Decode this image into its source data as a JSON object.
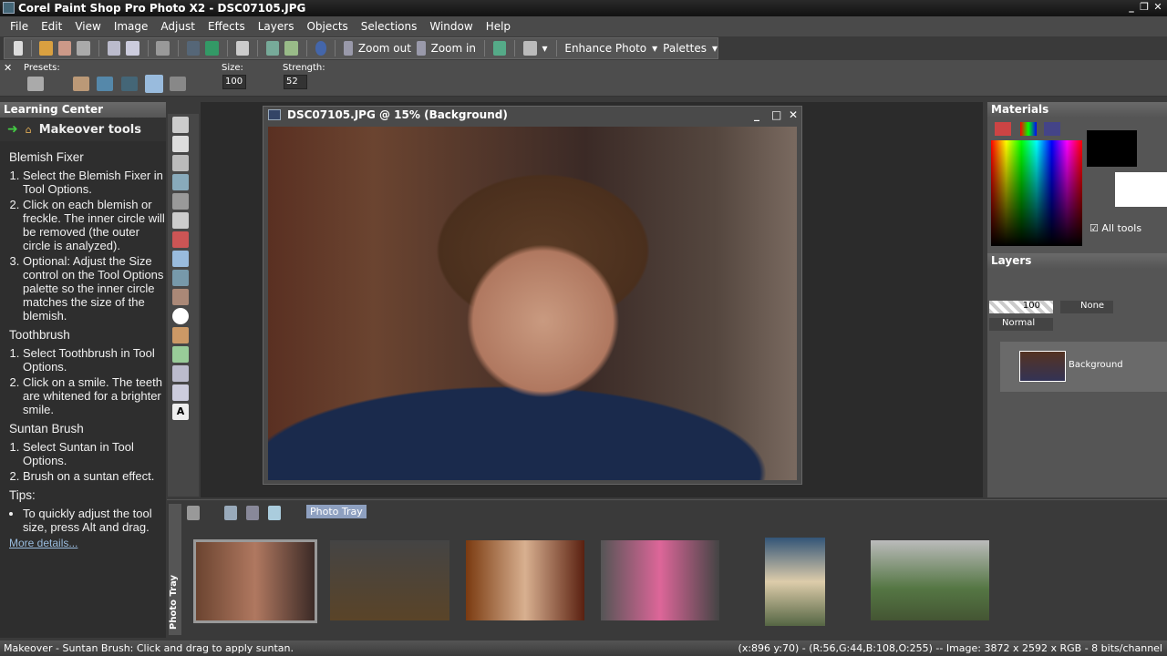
{
  "window": {
    "title": "Corel Paint Shop Pro Photo X2 - DSC07105.JPG"
  },
  "menu": [
    "File",
    "Edit",
    "View",
    "Image",
    "Adjust",
    "Effects",
    "Layers",
    "Objects",
    "Selections",
    "Window",
    "Help"
  ],
  "toolbar": {
    "zoom_out": "Zoom out",
    "zoom_in": "Zoom in",
    "enhance": "Enhance Photo",
    "palettes": "Palettes"
  },
  "options": {
    "presets_label": "Presets:",
    "size_label": "Size:",
    "size_value": "100",
    "strength_label": "Strength:",
    "strength_value": "52"
  },
  "learning": {
    "title": "Learning Center",
    "section": "Makeover tools",
    "groups": [
      {
        "heading": "Blemish Fixer",
        "steps": [
          "Select the Blemish Fixer in Tool Options.",
          "Click on each blemish or freckle. The inner circle will be removed (the outer circle is analyzed).",
          "Optional: Adjust the Size control on the Tool Options palette so the inner circle matches the size of the blemish."
        ]
      },
      {
        "heading": "Toothbrush",
        "steps": [
          "Select Toothbrush in Tool Options.",
          "Click on a smile. The teeth are whitened for a brighter smile."
        ]
      },
      {
        "heading": "Suntan Brush",
        "steps": [
          "Select Suntan in Tool Options.",
          "Brush on a suntan effect."
        ]
      }
    ],
    "tips_heading": "Tips:",
    "tip": "To quickly adjust the tool size, press Alt and drag.",
    "more": "More details..."
  },
  "image_window": {
    "title": "DSC07105.JPG @  15% (Background)"
  },
  "materials": {
    "title": "Materials",
    "all_tools": "All tools"
  },
  "layers": {
    "title": "Layers",
    "opacity": "100",
    "mask": "None",
    "blend": "Normal",
    "layer_name": "Background"
  },
  "tray": {
    "label": "Photo Tray",
    "side_label": "Photo Tray"
  },
  "status": {
    "left": "Makeover - Suntan Brush: Click and drag to apply suntan.",
    "right": "(x:896 y:70) - (R:56,G:44,B:108,O:255) -- Image:  3872 x 2592 x RGB - 8 bits/channel"
  }
}
